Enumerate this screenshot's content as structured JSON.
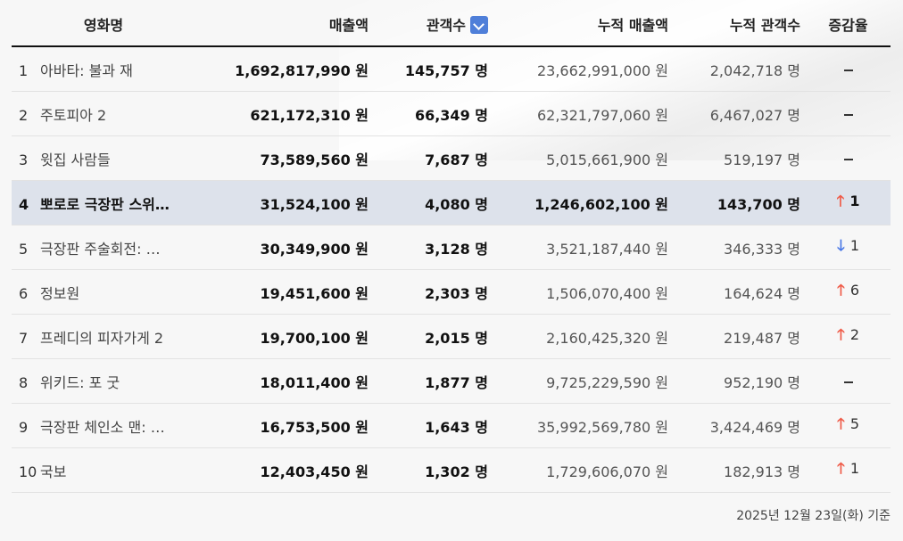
{
  "headers": {
    "title": "영화명",
    "sales": "매출액",
    "audience": "관객수",
    "cum_sales": "누적 매출액",
    "cum_audience": "누적 관객수",
    "change": "증감율"
  },
  "rows": [
    {
      "rank": "1",
      "title": "아바타: 불과 재",
      "sales": "1,692,817,990 원",
      "audience": "145,757 명",
      "cum_sales": "23,662,991,000 원",
      "cum_audience": "2,042,718 명",
      "change_dir": "none",
      "change_value": ""
    },
    {
      "rank": "2",
      "title": "주토피아 2",
      "sales": "621,172,310 원",
      "audience": "66,349 명",
      "cum_sales": "62,321,797,060 원",
      "cum_audience": "6,467,027 명",
      "change_dir": "none",
      "change_value": ""
    },
    {
      "rank": "3",
      "title": "윗집 사람들",
      "sales": "73,589,560 원",
      "audience": "7,687 명",
      "cum_sales": "5,015,661,900 원",
      "cum_audience": "519,197 명",
      "change_dir": "none",
      "change_value": ""
    },
    {
      "rank": "4",
      "title": "뽀로로 극장판 스위…",
      "sales": "31,524,100 원",
      "audience": "4,080 명",
      "cum_sales": "1,246,602,100 원",
      "cum_audience": "143,700 명",
      "change_dir": "up",
      "change_value": "1",
      "highlight": true
    },
    {
      "rank": "5",
      "title": "극장판 주술회전: …",
      "sales": "30,349,900 원",
      "audience": "3,128 명",
      "cum_sales": "3,521,187,440 원",
      "cum_audience": "346,333 명",
      "change_dir": "down",
      "change_value": "1"
    },
    {
      "rank": "6",
      "title": "정보원",
      "sales": "19,451,600 원",
      "audience": "2,303 명",
      "cum_sales": "1,506,070,400 원",
      "cum_audience": "164,624 명",
      "change_dir": "up",
      "change_value": "6"
    },
    {
      "rank": "7",
      "title": "프레디의 피자가게 2",
      "sales": "19,700,100 원",
      "audience": "2,015 명",
      "cum_sales": "2,160,425,320 원",
      "cum_audience": "219,487 명",
      "change_dir": "up",
      "change_value": "2"
    },
    {
      "rank": "8",
      "title": "위키드: 포 굿",
      "sales": "18,011,400 원",
      "audience": "1,877 명",
      "cum_sales": "9,725,229,590 원",
      "cum_audience": "952,190 명",
      "change_dir": "none",
      "change_value": ""
    },
    {
      "rank": "9",
      "title": "극장판 체인소 맨: …",
      "sales": "16,753,500 원",
      "audience": "1,643 명",
      "cum_sales": "35,992,569,780 원",
      "cum_audience": "3,424,469 명",
      "change_dir": "up",
      "change_value": "5"
    },
    {
      "rank": "10",
      "title": "국보",
      "sales": "12,403,450 원",
      "audience": "1,302 명",
      "cum_sales": "1,729,606,070 원",
      "cum_audience": "182,913 명",
      "change_dir": "up",
      "change_value": "1"
    }
  ],
  "colors": {
    "up": "#ef5a47",
    "down": "#4a78e6",
    "sort_button": "#4f7fd9",
    "highlight_row": "#dde2eb"
  },
  "sort_icon": "chevron-down-icon",
  "footer": "2025년 12월 23일(화) 기준"
}
